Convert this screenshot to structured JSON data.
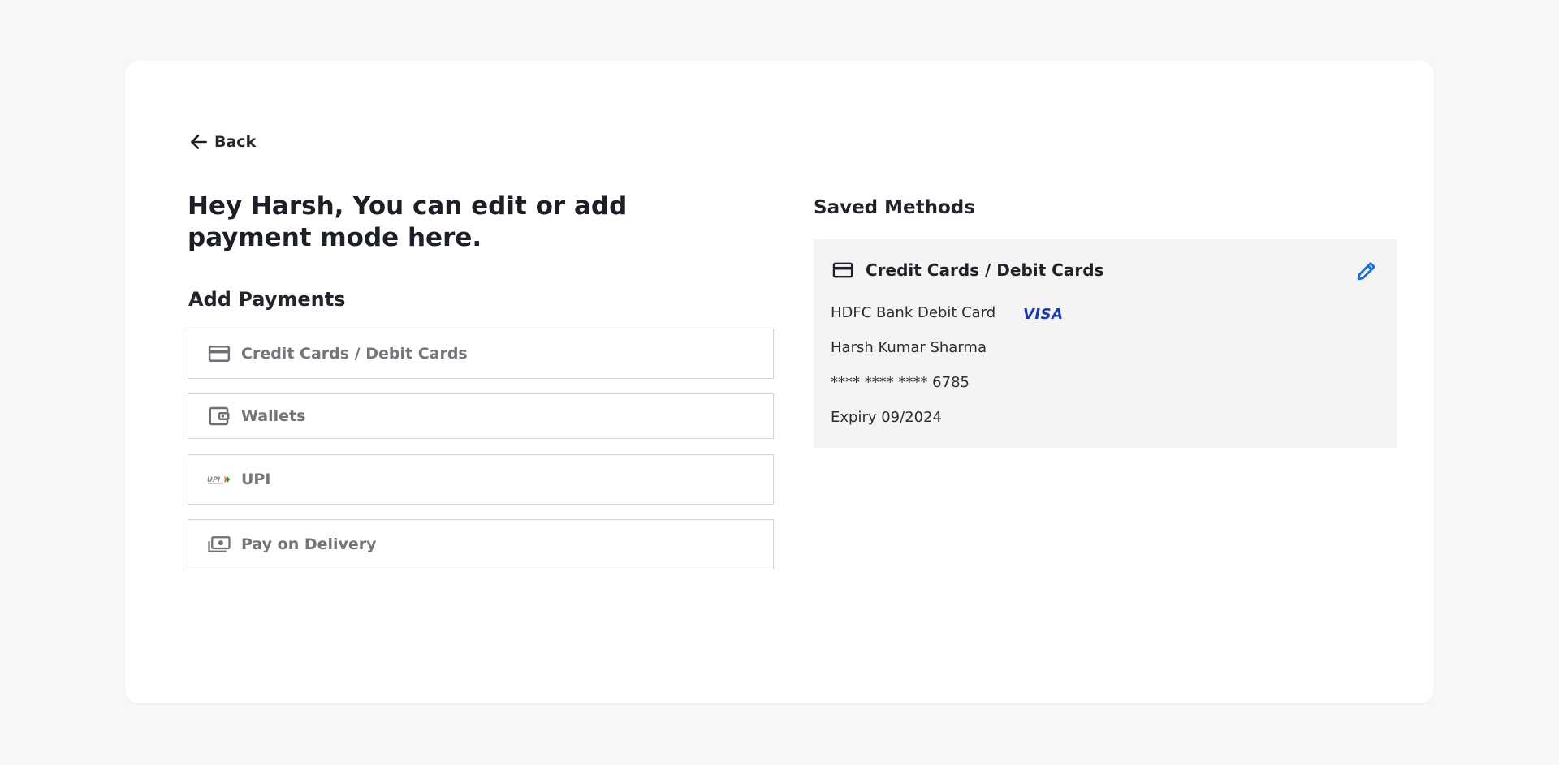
{
  "back": {
    "label": "Back"
  },
  "greeting": "Hey Harsh, You can edit or add payment mode here.",
  "add_payments": {
    "title": "Add Payments",
    "options": [
      {
        "label": "Credit Cards / Debit Cards",
        "icon": "credit-card-icon"
      },
      {
        "label": "Wallets",
        "icon": "wallet-icon"
      },
      {
        "label": "UPI",
        "icon": "upi-logo-icon"
      },
      {
        "label": "Pay on Delivery",
        "icon": "cash-icon"
      }
    ]
  },
  "saved_methods": {
    "title": "Saved Methods",
    "card": {
      "type_label": "Credit Cards / Debit Cards",
      "bank": "HDFC Bank Debit Card",
      "network": "VISA",
      "holder": "Harsh Kumar Sharma",
      "number": "**** **** **** 6785",
      "expiry": "Expiry 09/2024"
    }
  },
  "colors": {
    "accent_edit": "#1a6fd1",
    "visa_blue": "#1a3aa8",
    "page_bg": "#f7f7f7",
    "saved_bg": "#f4f4f4"
  }
}
